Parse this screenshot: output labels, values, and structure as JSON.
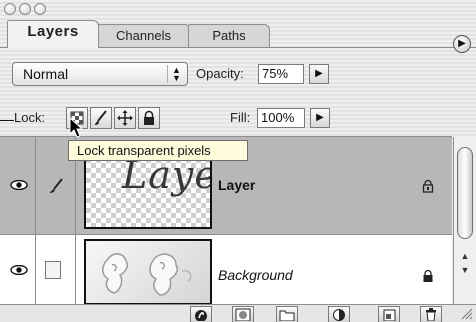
{
  "window": {
    "buttons": [
      "close",
      "minimize",
      "zoom"
    ]
  },
  "tabs": [
    {
      "label": "Layers",
      "active": true
    },
    {
      "label": "Channels",
      "active": false
    },
    {
      "label": "Paths",
      "active": false
    }
  ],
  "panel_menu_icon": "triangle-right-icon",
  "blend_mode": {
    "value": "Normal"
  },
  "opacity": {
    "label": "Opacity:",
    "value": "75%"
  },
  "lock": {
    "label": "Lock:"
  },
  "fill": {
    "label": "Fill:",
    "value": "100%"
  },
  "lock_buttons": [
    "lock-transparency-icon",
    "lock-image-brush-icon",
    "lock-position-move-icon",
    "lock-all-padlock-icon"
  ],
  "tooltip": {
    "text": "Lock transparent pixels"
  },
  "layers": [
    {
      "name": "Layer",
      "thumbnail_text": "Layer",
      "selected": true,
      "visible": true,
      "locked": true
    },
    {
      "name": "Background",
      "selected": false,
      "visible": true,
      "locked": true
    }
  ],
  "bottom_buttons": [
    "layer-style-icon",
    "layer-mask-icon",
    "new-set-folder-icon",
    "adjustment-layer-icon",
    "new-layer-icon",
    "trash-icon"
  ],
  "colors": {
    "panel_bg": "#e9e9e9",
    "selected_row": "#b7b7b7",
    "tooltip_bg": "#fffcdc"
  }
}
